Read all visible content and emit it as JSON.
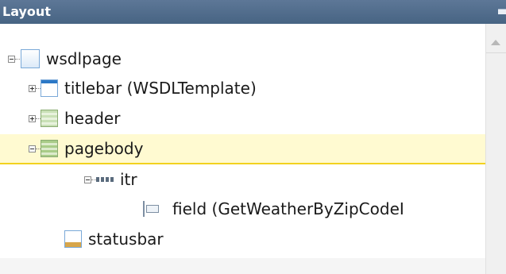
{
  "panel": {
    "title": "Layout"
  },
  "tree": {
    "nodes": [
      {
        "label": "wsdlpage",
        "icon": "page-icon",
        "toggle": "collapse"
      },
      {
        "label": "titlebar (WSDLTemplate)",
        "icon": "titlebar-icon",
        "toggle": "expand"
      },
      {
        "label": "header",
        "icon": "header-icon",
        "toggle": "expand"
      },
      {
        "label": "pagebody",
        "icon": "pagebody-icon",
        "toggle": "collapse",
        "selected": true
      },
      {
        "label": "itr",
        "icon": "iterator-icon",
        "toggle": "collapse"
      },
      {
        "label": "field (GetWeatherByZipCodeI",
        "icon": "field-icon"
      },
      {
        "label": "statusbar",
        "icon": "statusbar-icon"
      }
    ]
  },
  "colors": {
    "header_bg": "#476483",
    "selection_bg": "#fffad1",
    "selection_border": "#f2d21f"
  }
}
